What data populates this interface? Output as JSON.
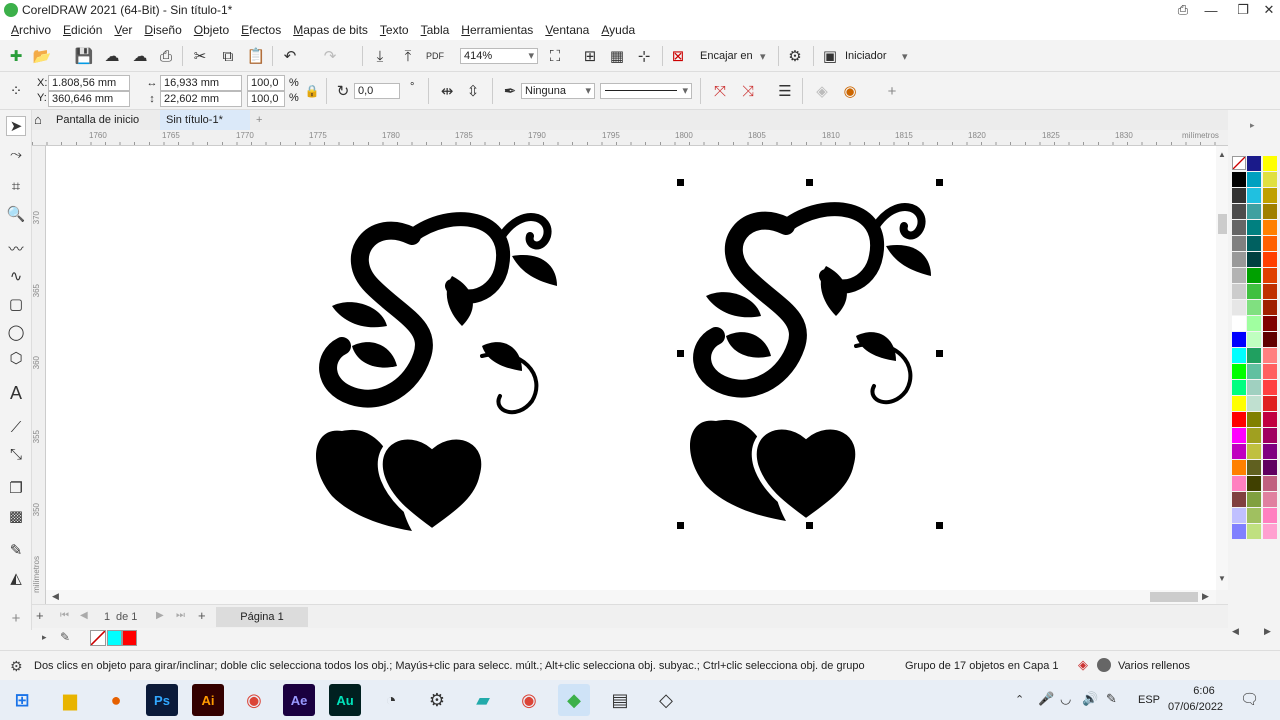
{
  "window": {
    "title": "CorelDRAW 2021 (64-Bit) - Sin título-1*"
  },
  "menu": [
    "Archivo",
    "Edición",
    "Ver",
    "Diseño",
    "Objeto",
    "Efectos",
    "Mapas de bits",
    "Texto",
    "Tabla",
    "Herramientas",
    "Ventana",
    "Ayuda"
  ],
  "toolbar": {
    "zoom": "414%",
    "snap_label": "Encajar en",
    "launch_label": "Iniciador"
  },
  "props": {
    "x_label": "X:",
    "y_label": "Y:",
    "x": "1.808,56 mm",
    "y": "360,646 mm",
    "w": "16,933 mm",
    "h": "22,602 mm",
    "sx": "100,0",
    "sy": "100,0",
    "pct": "%",
    "angle": "0,0",
    "deg": "°",
    "outline": "Ninguna"
  },
  "tabs": {
    "home": "Pantalla de inicio",
    "doc": "Sin título-1*"
  },
  "ruler": {
    "ticks": [
      "1760",
      "1765",
      "1770",
      "1775",
      "1780",
      "1785",
      "1790",
      "1795",
      "1800",
      "1805",
      "1810",
      "1815",
      "1820",
      "1825",
      "1830"
    ],
    "unit": "milímetros",
    "vticks": [
      "370",
      "365",
      "360",
      "355",
      "350"
    ],
    "vunit": "milímetros"
  },
  "pages": {
    "counter": "1",
    "of": "de 1",
    "tab": "Página 1"
  },
  "status": {
    "hint": "Dos clics en objeto para girar/inclinar; doble clic selecciona todos los obj.; Mayús+clic para selecc. múlt.; Alt+clic selecciona obj. subyac.; Ctrl+clic selecciona obj. de grupo",
    "selection": "Grupo de 17 objetos en Capa 1",
    "fill": "Varios rellenos"
  },
  "taskbar": {
    "apps": [
      "Ps",
      "Ai",
      "Ae",
      "Au"
    ],
    "lang": "ESP",
    "time": "6:06",
    "date": "07/06/2022"
  },
  "colors": {
    "accent": "#1a73e8",
    "palette_col1": [
      "#000000",
      "#333333",
      "#4d4d4d",
      "#666666",
      "#808080",
      "#999999",
      "#b3b3b3",
      "#cccccc",
      "#e6e6e6",
      "#ffffff",
      "#0000ff",
      "#00ffff",
      "#00ff00",
      "#00ff80",
      "#ffff00",
      "#ff0000",
      "#ff00ff",
      "#c000c0",
      "#ff8000",
      "#ff80c0",
      "#804040",
      "#c0c0ff",
      "#8080ff",
      "#4040c0",
      "#0000a0",
      "#000080"
    ],
    "palette_col2": [
      "#1a1a8a",
      "#00a0c0",
      "#20c0e0",
      "#40a0a0",
      "#008080",
      "#006060",
      "#004040",
      "#00a000",
      "#40c040",
      "#80e080",
      "#a0ffa0",
      "#c0ffc0",
      "#20a060",
      "#60c0a0",
      "#a0d0c0",
      "#c0e0d0",
      "#808000",
      "#a0a020",
      "#c0c040",
      "#606020",
      "#404000",
      "#80a040",
      "#a0c060",
      "#c0e080",
      "#e0ff80",
      "#ffff80"
    ],
    "palette_col3": [
      "#ffff00",
      "#e0e040",
      "#c0a000",
      "#a08000",
      "#ff8000",
      "#ff6000",
      "#ff4000",
      "#e04000",
      "#c03000",
      "#a02000",
      "#800000",
      "#600000",
      "#ff8080",
      "#ff6060",
      "#ff4040",
      "#e02020",
      "#c00040",
      "#a00060",
      "#800080",
      "#600060",
      "#c06080",
      "#e080a0",
      "#ff80c0",
      "#ffa0d0",
      "#ffc0e0",
      "#ffe0f0"
    ],
    "docpal": [
      "#00ffff",
      "#ff0000"
    ]
  }
}
